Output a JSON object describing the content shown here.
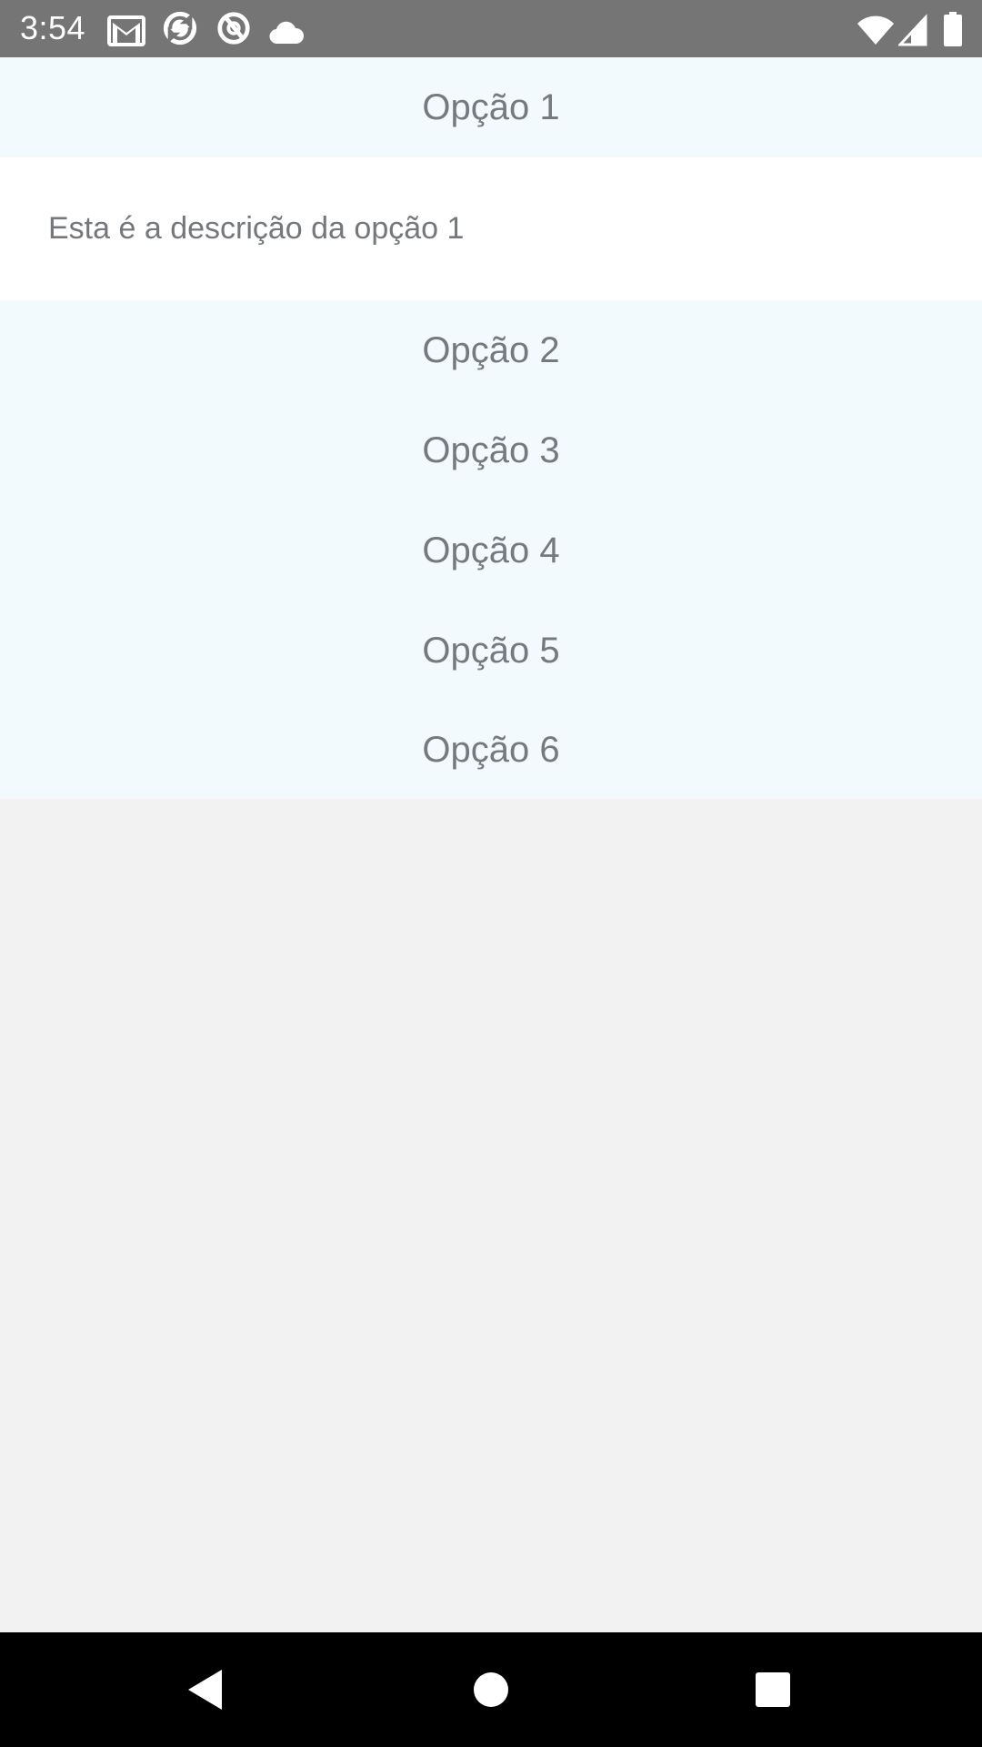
{
  "status_bar": {
    "time": "3:54",
    "icons": [
      "gmail-icon",
      "sync-app-icon",
      "no-sync-icon",
      "cloud-icon",
      "wifi-icon",
      "signal-icon",
      "battery-icon"
    ]
  },
  "accordion": {
    "items": [
      {
        "title": "Opção 1",
        "description": "Esta é a descrição da opção 1",
        "expanded": true
      },
      {
        "title": "Opção 2",
        "expanded": false
      },
      {
        "title": "Opção 3",
        "expanded": false
      },
      {
        "title": "Opção 4",
        "expanded": false
      },
      {
        "title": "Opção 5",
        "expanded": false
      },
      {
        "title": "Opção 6",
        "expanded": false
      }
    ]
  },
  "nav_bar": {
    "buttons": [
      "back-icon",
      "home-icon",
      "recents-icon"
    ]
  },
  "colors": {
    "status_bar_bg": "#757575",
    "header_bg": "#f3fafe",
    "body_bg": "#ffffff",
    "screen_bg": "#f2f2f2",
    "text": "#757a7f"
  }
}
